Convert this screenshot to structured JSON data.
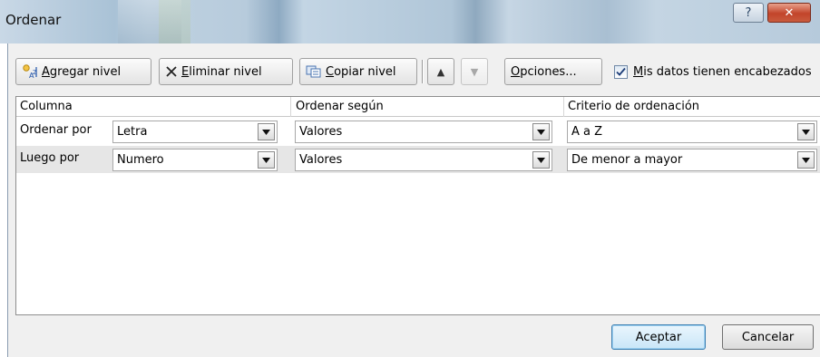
{
  "window": {
    "title": "Ordenar",
    "help_label": "?",
    "close_label": "✕"
  },
  "toolbar": {
    "add_level": {
      "label_pre": "",
      "accel": "A",
      "label_post": "gregar nivel",
      "icon": "add-level-icon"
    },
    "delete_level": {
      "accel": "E",
      "label_post": "liminar nivel",
      "icon": "x-icon"
    },
    "copy_level": {
      "accel": "C",
      "label_post": "opiar nivel",
      "icon": "copy-icon"
    },
    "move_up": {
      "glyph": "▲",
      "icon": "arrow-up-icon"
    },
    "move_down": {
      "glyph": "▼",
      "icon": "arrow-down-icon"
    },
    "options": {
      "accel": "O",
      "label_post": "pciones..."
    },
    "headers_checkbox": {
      "checked": true,
      "accel": "M",
      "label_post": "is datos tienen encabezados"
    }
  },
  "grid": {
    "columns": [
      "Columna",
      "Ordenar según",
      "Criterio de ordenación"
    ],
    "rows": [
      {
        "label": "Ordenar por",
        "column": "Letra",
        "sort_on": "Valores",
        "order": "A a Z",
        "selected": false
      },
      {
        "label": "Luego por",
        "column": "Numero",
        "sort_on": "Valores",
        "order": "De menor a mayor",
        "selected": true
      }
    ]
  },
  "footer": {
    "ok_label": "Aceptar",
    "cancel_label": "Cancelar"
  },
  "colors": {
    "dialog_bg": "#f0f0f0",
    "selected_row": "#e6e6e6",
    "close_button": "#c2442a",
    "default_button_border": "#3c7fb1"
  }
}
